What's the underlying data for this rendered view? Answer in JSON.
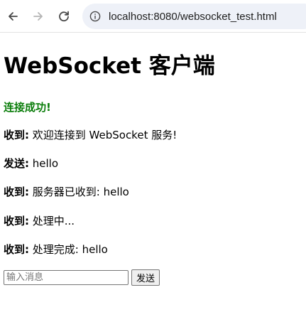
{
  "browser": {
    "url": "localhost:8080/websocket_test.html",
    "icons": {
      "back": "back-arrow-icon",
      "forward": "forward-arrow-icon",
      "reload": "reload-icon",
      "site_info": "info-icon"
    }
  },
  "page": {
    "title": "WebSocket 客户端",
    "status": "连接成功!",
    "status_color": "#0a7d0a",
    "messages": [
      {
        "who": "收到:",
        "text": " 欢迎连接到 WebSocket 服务!"
      },
      {
        "who": "发送:",
        "text": " hello"
      },
      {
        "who": "收到:",
        "text": " 服务器已收到: hello"
      },
      {
        "who": "收到:",
        "text": " 处理中..."
      },
      {
        "who": "收到:",
        "text": " 处理完成: hello"
      }
    ],
    "input": {
      "value": "",
      "placeholder": "输入消息"
    },
    "send_label": "发送"
  }
}
